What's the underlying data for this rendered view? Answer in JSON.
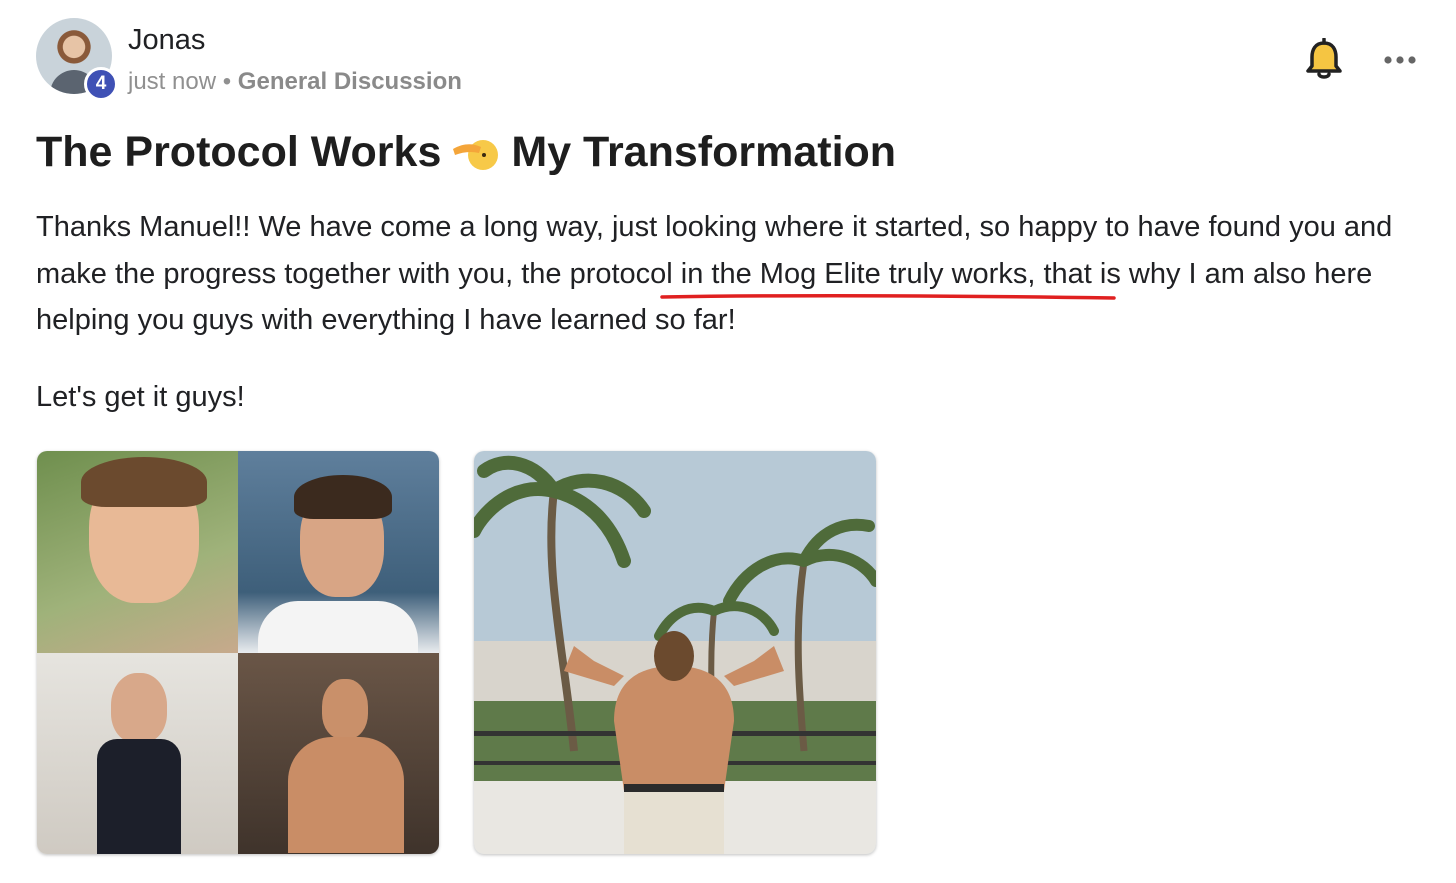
{
  "post": {
    "author": "Jonas",
    "level": "4",
    "timestamp": "just now",
    "separator": "•",
    "category": "General Discussion",
    "title_part1": "The Protocol Works",
    "title_part2": "My Transformation",
    "body_before": "Thanks Manuel!! We have come a long way, just looking where it started, so happy to have found you and make the progress together with you, the ",
    "body_highlight": "protocol in the Mog Elite truly works",
    "body_after": ", that is why I am also here helping you guys with everything I have learned so far!",
    "closing": "Let's get it guys!"
  },
  "icons": {
    "avatar": "user-avatar",
    "bell": "bell-icon",
    "more": "more-options-icon",
    "emoji": "saluting-face-emoji"
  },
  "images": {
    "first": "before-after-collage",
    "second": "flexing-back-photo"
  },
  "colors": {
    "badge": "#3f51b5",
    "bell": "#f5c542",
    "underline": "#e02020"
  }
}
